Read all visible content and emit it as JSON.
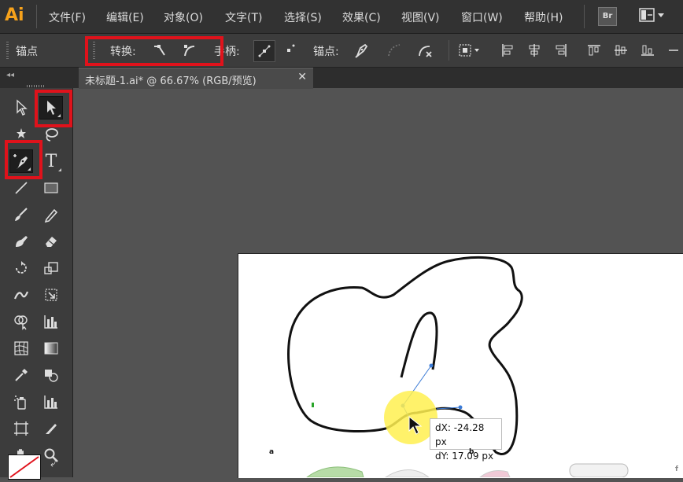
{
  "app": {
    "logo": "Ai"
  },
  "menu": [
    "文件(F)",
    "编辑(E)",
    "对象(O)",
    "文字(T)",
    "选择(S)",
    "效果(C)",
    "视图(V)",
    "窗口(W)",
    "帮助(H)"
  ],
  "top_buttons": {
    "bridge": "Br"
  },
  "control": {
    "context_label": "锚点",
    "convert_label": "转换:",
    "handles_label": "手柄:",
    "anchor_label": "锚点:"
  },
  "document": {
    "tab_title": "未标题-1.ai* @ 66.67% (RGB/预览)",
    "close_glyph": "✕"
  },
  "measure": {
    "dx": "dX: -24.28 px",
    "dy": "dY: 17.09 px"
  },
  "art_labels": {
    "a": "a",
    "b": "b",
    "f": "f"
  },
  "colors": {
    "highlight_box": "#e0121b",
    "ai_orange": "#f7a21b",
    "path_anchor": "#3b7bd6"
  }
}
